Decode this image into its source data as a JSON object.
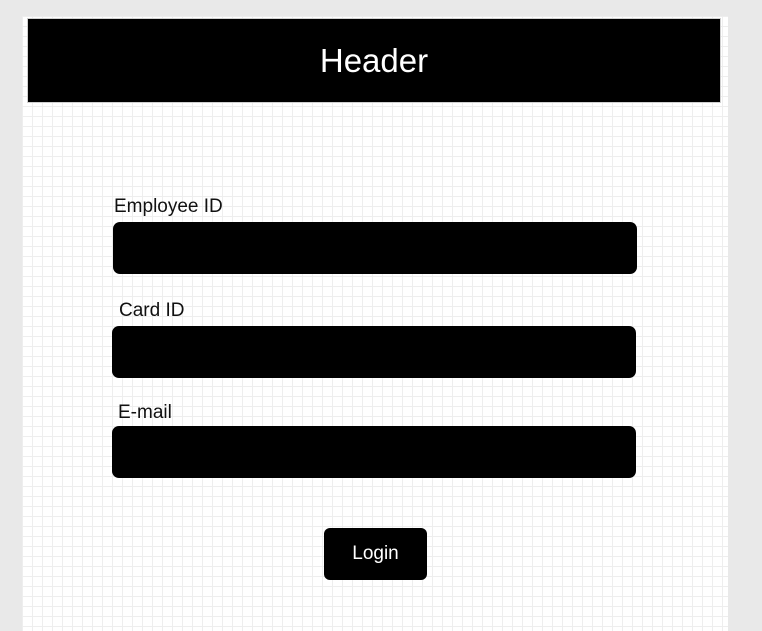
{
  "header": {
    "title": "Header"
  },
  "form": {
    "fields": [
      {
        "label": "Employee ID",
        "value": "",
        "placeholder": ""
      },
      {
        "label": "Card ID",
        "value": "",
        "placeholder": ""
      },
      {
        "label": "E-mail",
        "value": "",
        "placeholder": ""
      }
    ],
    "login_label": "Login"
  },
  "colors": {
    "background": "#e9e9e9",
    "canvas": "#ffffff",
    "header_bg": "#000000",
    "header_text": "#ffffff",
    "input_bg": "#000000",
    "button_bg": "#000000",
    "button_text": "#ffffff",
    "label_text": "#111111"
  }
}
